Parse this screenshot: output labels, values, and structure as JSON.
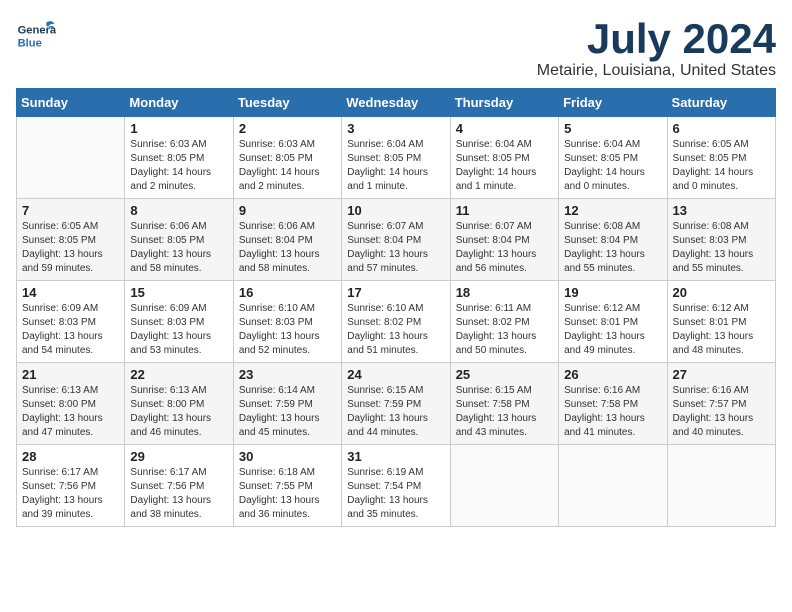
{
  "header": {
    "logo_general": "General",
    "logo_blue": "Blue",
    "main_title": "July 2024",
    "sub_title": "Metairie, Louisiana, United States"
  },
  "calendar": {
    "days_of_week": [
      "Sunday",
      "Monday",
      "Tuesday",
      "Wednesday",
      "Thursday",
      "Friday",
      "Saturday"
    ],
    "weeks": [
      [
        {
          "day": "",
          "info": ""
        },
        {
          "day": "1",
          "info": "Sunrise: 6:03 AM\nSunset: 8:05 PM\nDaylight: 14 hours\nand 2 minutes."
        },
        {
          "day": "2",
          "info": "Sunrise: 6:03 AM\nSunset: 8:05 PM\nDaylight: 14 hours\nand 2 minutes."
        },
        {
          "day": "3",
          "info": "Sunrise: 6:04 AM\nSunset: 8:05 PM\nDaylight: 14 hours\nand 1 minute."
        },
        {
          "day": "4",
          "info": "Sunrise: 6:04 AM\nSunset: 8:05 PM\nDaylight: 14 hours\nand 1 minute."
        },
        {
          "day": "5",
          "info": "Sunrise: 6:04 AM\nSunset: 8:05 PM\nDaylight: 14 hours\nand 0 minutes."
        },
        {
          "day": "6",
          "info": "Sunrise: 6:05 AM\nSunset: 8:05 PM\nDaylight: 14 hours\nand 0 minutes."
        }
      ],
      [
        {
          "day": "7",
          "info": "Sunrise: 6:05 AM\nSunset: 8:05 PM\nDaylight: 13 hours\nand 59 minutes."
        },
        {
          "day": "8",
          "info": "Sunrise: 6:06 AM\nSunset: 8:05 PM\nDaylight: 13 hours\nand 58 minutes."
        },
        {
          "day": "9",
          "info": "Sunrise: 6:06 AM\nSunset: 8:04 PM\nDaylight: 13 hours\nand 58 minutes."
        },
        {
          "day": "10",
          "info": "Sunrise: 6:07 AM\nSunset: 8:04 PM\nDaylight: 13 hours\nand 57 minutes."
        },
        {
          "day": "11",
          "info": "Sunrise: 6:07 AM\nSunset: 8:04 PM\nDaylight: 13 hours\nand 56 minutes."
        },
        {
          "day": "12",
          "info": "Sunrise: 6:08 AM\nSunset: 8:04 PM\nDaylight: 13 hours\nand 55 minutes."
        },
        {
          "day": "13",
          "info": "Sunrise: 6:08 AM\nSunset: 8:03 PM\nDaylight: 13 hours\nand 55 minutes."
        }
      ],
      [
        {
          "day": "14",
          "info": "Sunrise: 6:09 AM\nSunset: 8:03 PM\nDaylight: 13 hours\nand 54 minutes."
        },
        {
          "day": "15",
          "info": "Sunrise: 6:09 AM\nSunset: 8:03 PM\nDaylight: 13 hours\nand 53 minutes."
        },
        {
          "day": "16",
          "info": "Sunrise: 6:10 AM\nSunset: 8:03 PM\nDaylight: 13 hours\nand 52 minutes."
        },
        {
          "day": "17",
          "info": "Sunrise: 6:10 AM\nSunset: 8:02 PM\nDaylight: 13 hours\nand 51 minutes."
        },
        {
          "day": "18",
          "info": "Sunrise: 6:11 AM\nSunset: 8:02 PM\nDaylight: 13 hours\nand 50 minutes."
        },
        {
          "day": "19",
          "info": "Sunrise: 6:12 AM\nSunset: 8:01 PM\nDaylight: 13 hours\nand 49 minutes."
        },
        {
          "day": "20",
          "info": "Sunrise: 6:12 AM\nSunset: 8:01 PM\nDaylight: 13 hours\nand 48 minutes."
        }
      ],
      [
        {
          "day": "21",
          "info": "Sunrise: 6:13 AM\nSunset: 8:00 PM\nDaylight: 13 hours\nand 47 minutes."
        },
        {
          "day": "22",
          "info": "Sunrise: 6:13 AM\nSunset: 8:00 PM\nDaylight: 13 hours\nand 46 minutes."
        },
        {
          "day": "23",
          "info": "Sunrise: 6:14 AM\nSunset: 7:59 PM\nDaylight: 13 hours\nand 45 minutes."
        },
        {
          "day": "24",
          "info": "Sunrise: 6:15 AM\nSunset: 7:59 PM\nDaylight: 13 hours\nand 44 minutes."
        },
        {
          "day": "25",
          "info": "Sunrise: 6:15 AM\nSunset: 7:58 PM\nDaylight: 13 hours\nand 43 minutes."
        },
        {
          "day": "26",
          "info": "Sunrise: 6:16 AM\nSunset: 7:58 PM\nDaylight: 13 hours\nand 41 minutes."
        },
        {
          "day": "27",
          "info": "Sunrise: 6:16 AM\nSunset: 7:57 PM\nDaylight: 13 hours\nand 40 minutes."
        }
      ],
      [
        {
          "day": "28",
          "info": "Sunrise: 6:17 AM\nSunset: 7:56 PM\nDaylight: 13 hours\nand 39 minutes."
        },
        {
          "day": "29",
          "info": "Sunrise: 6:17 AM\nSunset: 7:56 PM\nDaylight: 13 hours\nand 38 minutes."
        },
        {
          "day": "30",
          "info": "Sunrise: 6:18 AM\nSunset: 7:55 PM\nDaylight: 13 hours\nand 36 minutes."
        },
        {
          "day": "31",
          "info": "Sunrise: 6:19 AM\nSunset: 7:54 PM\nDaylight: 13 hours\nand 35 minutes."
        },
        {
          "day": "",
          "info": ""
        },
        {
          "day": "",
          "info": ""
        },
        {
          "day": "",
          "info": ""
        }
      ]
    ]
  }
}
